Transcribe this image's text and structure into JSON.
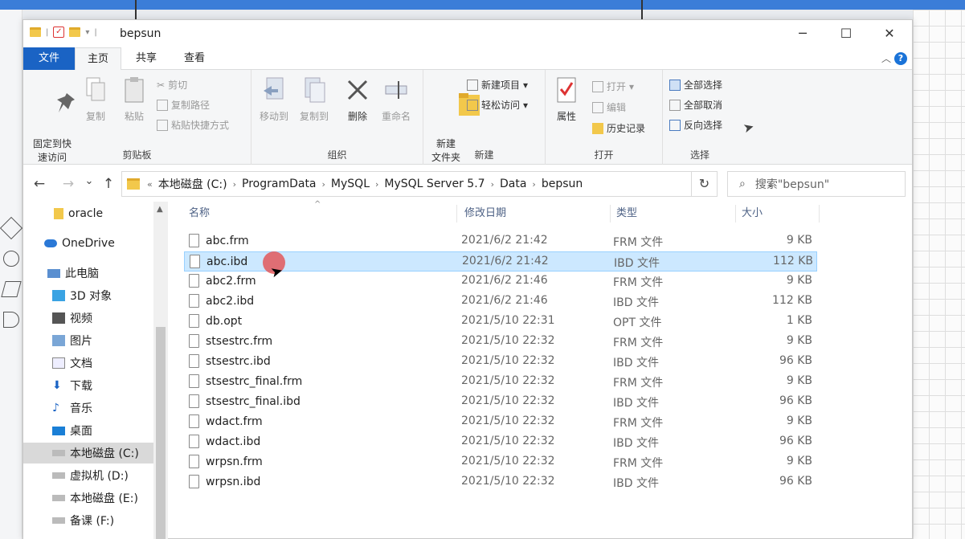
{
  "window": {
    "title": "bepsun",
    "controls": {
      "minimize": "─",
      "maximize": "☐",
      "close": "✕"
    }
  },
  "ribbon_tabs": [
    "文件",
    "主页",
    "共享",
    "查看"
  ],
  "ribbon": {
    "clipboard": {
      "label": "剪贴板",
      "pin": "固定到快\n速访问",
      "copy": "复制",
      "paste": "粘贴",
      "cut": "剪切",
      "copy_path": "复制路径",
      "paste_shortcut": "粘贴快捷方式"
    },
    "organize": {
      "label": "组织",
      "move_to": "移动到",
      "copy_to": "复制到",
      "delete": "删除",
      "rename": "重命名"
    },
    "new": {
      "label": "新建",
      "new_folder": "新建\n文件夹",
      "new_item": "新建项目",
      "easy_access": "轻松访问"
    },
    "open": {
      "label": "打开",
      "properties": "属性",
      "open": "打开",
      "edit": "编辑",
      "history": "历史记录"
    },
    "select": {
      "label": "选择",
      "select_all": "全部选择",
      "select_none": "全部取消",
      "invert": "反向选择"
    }
  },
  "nav": {
    "back": "←",
    "forward": "→",
    "recent": "⌄",
    "up": "↑",
    "refresh": "↻",
    "dropdown": "⌄",
    "breadcrumb": [
      "本地磁盘 (C:)",
      "ProgramData",
      "MySQL",
      "MySQL Server 5.7",
      "Data",
      "bepsun"
    ],
    "search_placeholder": "搜索\"bepsun\""
  },
  "sidebar": [
    {
      "label": "oracle",
      "icon": "folder-icon"
    },
    {
      "label": "OneDrive",
      "icon": "cloud-icon"
    },
    {
      "label": "此电脑",
      "icon": "computer-icon"
    },
    {
      "label": "3D 对象",
      "icon": "cube-icon"
    },
    {
      "label": "视频",
      "icon": "video-icon"
    },
    {
      "label": "图片",
      "icon": "picture-icon"
    },
    {
      "label": "文档",
      "icon": "document-icon"
    },
    {
      "label": "下载",
      "icon": "download-icon"
    },
    {
      "label": "音乐",
      "icon": "music-icon"
    },
    {
      "label": "桌面",
      "icon": "desktop-icon"
    },
    {
      "label": "本地磁盘 (C:)",
      "icon": "drive-icon",
      "selected": true
    },
    {
      "label": "虚拟机 (D:)",
      "icon": "drive-icon"
    },
    {
      "label": "本地磁盘 (E:)",
      "icon": "drive-icon"
    },
    {
      "label": "备课 (F:)",
      "icon": "drive-icon"
    }
  ],
  "columns": {
    "name": "名称",
    "modified": "修改日期",
    "type": "类型",
    "size": "大小"
  },
  "files": [
    {
      "name": "abc.frm",
      "date": "2021/6/2 21:42",
      "type": "FRM 文件",
      "size": "9 KB"
    },
    {
      "name": "abc.ibd",
      "date": "2021/6/2 21:42",
      "type": "IBD 文件",
      "size": "112 KB",
      "selected": true
    },
    {
      "name": "abc2.frm",
      "date": "2021/6/2 21:46",
      "type": "FRM 文件",
      "size": "9 KB"
    },
    {
      "name": "abc2.ibd",
      "date": "2021/6/2 21:46",
      "type": "IBD 文件",
      "size": "112 KB"
    },
    {
      "name": "db.opt",
      "date": "2021/5/10 22:31",
      "type": "OPT 文件",
      "size": "1 KB"
    },
    {
      "name": "stsestrc.frm",
      "date": "2021/5/10 22:32",
      "type": "FRM 文件",
      "size": "9 KB"
    },
    {
      "name": "stsestrc.ibd",
      "date": "2021/5/10 22:32",
      "type": "IBD 文件",
      "size": "96 KB"
    },
    {
      "name": "stsestrc_final.frm",
      "date": "2021/5/10 22:32",
      "type": "FRM 文件",
      "size": "9 KB"
    },
    {
      "name": "stsestrc_final.ibd",
      "date": "2021/5/10 22:32",
      "type": "IBD 文件",
      "size": "96 KB"
    },
    {
      "name": "wdact.frm",
      "date": "2021/5/10 22:32",
      "type": "FRM 文件",
      "size": "9 KB"
    },
    {
      "name": "wdact.ibd",
      "date": "2021/5/10 22:32",
      "type": "IBD 文件",
      "size": "96 KB"
    },
    {
      "name": "wrpsn.frm",
      "date": "2021/5/10 22:32",
      "type": "FRM 文件",
      "size": "9 KB"
    },
    {
      "name": "wrpsn.ibd",
      "date": "2021/5/10 22:32",
      "type": "IBD 文件",
      "size": "96 KB"
    }
  ],
  "colors": {
    "accent": "#1a63c4",
    "selection": "#cce8ff",
    "selection_border": "#99d1ff",
    "folder": "#f2c84b"
  }
}
